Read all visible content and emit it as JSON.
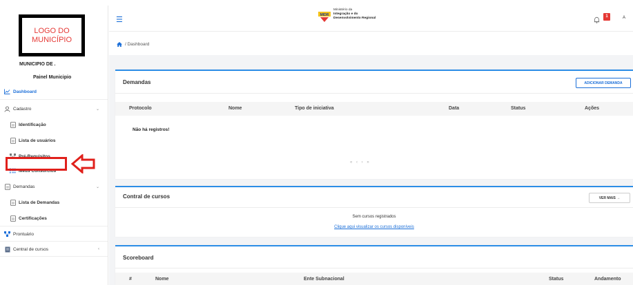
{
  "sidebar": {
    "logo_text": "LOGO DO MUNICÍPIO",
    "municipality_name": "MUNICIPIO DE .",
    "panel_title": "Painel Municipio",
    "items": [
      {
        "label": "Dashboard",
        "icon": "chart-line-icon"
      },
      {
        "label": "Cadastro",
        "icon": "user-icon"
      },
      {
        "label": "Identificação",
        "icon": "document-icon"
      },
      {
        "label": "Lista de usuários",
        "icon": "document-icon"
      },
      {
        "label": "Pré-Requisitos",
        "icon": "nodes-icon"
      },
      {
        "label": "Meus Consórcios",
        "icon": "list-icon"
      },
      {
        "label": "Demandas",
        "icon": "document-icon"
      },
      {
        "label": "Lista de Demandas",
        "icon": "document-icon"
      },
      {
        "label": "Certificações",
        "icon": "document-icon"
      },
      {
        "label": "Prontuário",
        "icon": "nodes-icon"
      },
      {
        "label": "Central de cursos",
        "icon": "book-icon"
      }
    ]
  },
  "header": {
    "brand_line1": "Ministério da",
    "brand_line2": "Integração e do",
    "brand_line3": "Desenvolvimento Regional",
    "brand_abbrev": "MIDR",
    "notification_count": "1",
    "avatar_initial": "A"
  },
  "breadcrumb": {
    "text": "/ Dashboard"
  },
  "demandas": {
    "title": "Demandas",
    "add_button": "ADICIONAR DEMANDA",
    "columns": [
      "Protocolo",
      "Nome",
      "Tipo de iniciativa",
      "Data",
      "Status",
      "Ações"
    ],
    "empty_text": "Não há registros!",
    "pager": "«  ‹  ›  »"
  },
  "cursos": {
    "title": "Contral de cursos",
    "more_button": "VER MAIS →",
    "empty_text": "Sem cursos registrados",
    "link_text": "Clique aqui visualizar os cursos disponíveis"
  },
  "scoreboard": {
    "title": "Scoreboard",
    "columns": [
      "#",
      "Nome",
      "Ente Subnacional",
      "Status",
      "Andamento"
    ]
  },
  "colors": {
    "accent": "#1a6ed8",
    "highlight": "#e0201b",
    "notification": "#e53935"
  }
}
